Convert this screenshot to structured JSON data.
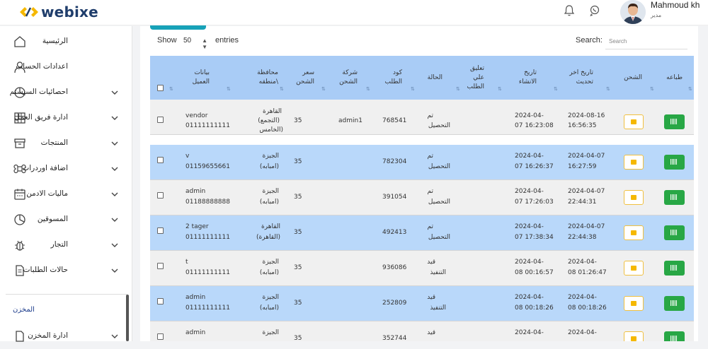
{
  "brand": {
    "name": "webixe"
  },
  "user": {
    "name": "Mahmoud kh",
    "role": "مدير"
  },
  "sidebar": {
    "items": [
      {
        "label": "الرئيسية",
        "icon": "home-icon",
        "has_chevron": false
      },
      {
        "label": "اعدادات الحساب",
        "icon": "user-icon",
        "has_chevron": false
      },
      {
        "label": "احصائيات السيستم",
        "icon": "pie-chart-icon",
        "has_chevron": true
      },
      {
        "label": "ادارة فريق العمل",
        "icon": "grid-icon",
        "has_chevron": true
      },
      {
        "label": "المنتجات",
        "icon": "box-icon",
        "has_chevron": true
      },
      {
        "label": "اضافة اوردرات",
        "icon": "command-icon",
        "has_chevron": true
      },
      {
        "label": "ماليات الادمن",
        "icon": "calendar-icon",
        "has_chevron": true
      },
      {
        "label": "المسوقين",
        "icon": "pie-chart-icon",
        "has_chevron": true
      },
      {
        "label": "التجار",
        "icon": "bug-icon",
        "has_chevron": true
      },
      {
        "label": "حالات الطلبات",
        "icon": "document-icon",
        "has_chevron": true
      }
    ],
    "section_title": "المخزن",
    "cut_item": {
      "label": "ادارة المخزن",
      "icon": "document-icon"
    }
  },
  "table_controls": {
    "show_label": "Show",
    "page_size": "50",
    "entries_label": "entries",
    "search_label": "Search:",
    "search_placeholder": "Search"
  },
  "table": {
    "columns": [
      {
        "key": "print",
        "label": "طباعه"
      },
      {
        "key": "ship",
        "label": "الشحن"
      },
      {
        "key": "updated",
        "label": "تاريخ اخر تحديث"
      },
      {
        "key": "created",
        "label": "تاريخ الانشاء"
      },
      {
        "key": "comment",
        "label": "تعليق علي الطلب"
      },
      {
        "key": "status",
        "label": "الحالة"
      },
      {
        "key": "code",
        "label": "كود الطلب"
      },
      {
        "key": "company",
        "label": "شركة الشحن"
      },
      {
        "key": "price",
        "label": "سعر الشحن"
      },
      {
        "key": "region",
        "label": "محافظة \\منطقه"
      },
      {
        "key": "client",
        "label": "بيانات العميل"
      }
    ],
    "rows": [
      {
        "client_name": "vendor",
        "client_phone": "01111111111",
        "region_a": "القاهرة",
        "region_b": "(التجمع)",
        "region_c": "(الخامس",
        "price": "35",
        "company": "admin1",
        "code": "768541",
        "status_a": "تم",
        "status_b": "التحصيل",
        "created_a": "2024-04-",
        "created_b": "07 16:23:08",
        "updated_a": "2024-08-16",
        "updated_b": "16:56:35"
      },
      {
        "client_name": "v",
        "client_phone": "01159655661",
        "region_a": "الجيزة",
        "region_b": "(امبابه)",
        "region_c": "",
        "price": "35",
        "company": "",
        "code": "782304",
        "status_a": "تم",
        "status_b": "التحصيل",
        "created_a": "2024-04-",
        "created_b": "07 16:26:37",
        "updated_a": "2024-04-07",
        "updated_b": "16:27:59"
      },
      {
        "client_name": "admin",
        "client_phone": "01188888888",
        "region_a": "الجيزة",
        "region_b": "(امبابه)",
        "region_c": "",
        "price": "35",
        "company": "",
        "code": "391054",
        "status_a": "تم",
        "status_b": "التحصيل",
        "created_a": "2024-04-",
        "created_b": "07 17:26:03",
        "updated_a": "2024-04-07",
        "updated_b": "22:44:31"
      },
      {
        "client_name": "2 tager",
        "client_phone": "01111111111",
        "region_a": "القاهرة",
        "region_b": "(القاهرة)",
        "region_c": "",
        "price": "35",
        "company": "",
        "code": "492413",
        "status_a": "تم",
        "status_b": "التحصيل",
        "created_a": "2024-04-",
        "created_b": "07 17:38:34",
        "updated_a": "2024-04-07",
        "updated_b": "22:44:38"
      },
      {
        "client_name": "t",
        "client_phone": "01111111111",
        "region_a": "الجيزة",
        "region_b": "(امبابه)",
        "region_c": "",
        "price": "35",
        "company": "",
        "code": "936086",
        "status_a": "قيد",
        "status_b": "التنفيذ",
        "created_a": "2024-04-",
        "created_b": "08 00:16:57",
        "updated_a": "2024-04-",
        "updated_b": "08 01:26:47"
      },
      {
        "client_name": "admin",
        "client_phone": "01111111111",
        "region_a": "الجيزة",
        "region_b": "(امبابه)",
        "region_c": "",
        "price": "35",
        "company": "",
        "code": "252809",
        "status_a": "قيد",
        "status_b": "التنفيذ",
        "created_a": "2024-04-",
        "created_b": "08 00:18:26",
        "updated_a": "2024-04-",
        "updated_b": "08 00:18:26"
      },
      {
        "client_name": "admin",
        "client_phone": "",
        "region_a": "الجيزة",
        "region_b": "",
        "region_c": "",
        "price": "35",
        "company": "",
        "code": "352744",
        "status_a": "قيد",
        "status_b": "",
        "created_a": "2024-04-",
        "created_b": "",
        "updated_a": "2024-04-",
        "updated_b": ""
      }
    ]
  },
  "colors": {
    "header_blue": "#a9ccf6",
    "row_blue": "#b9d8fa",
    "print_green": "#28a745",
    "ship_yellow": "#f5b800",
    "accent_teal": "#17a2b8",
    "logo_navy": "#1f3d6b",
    "logo_gold": "#f5b800"
  }
}
